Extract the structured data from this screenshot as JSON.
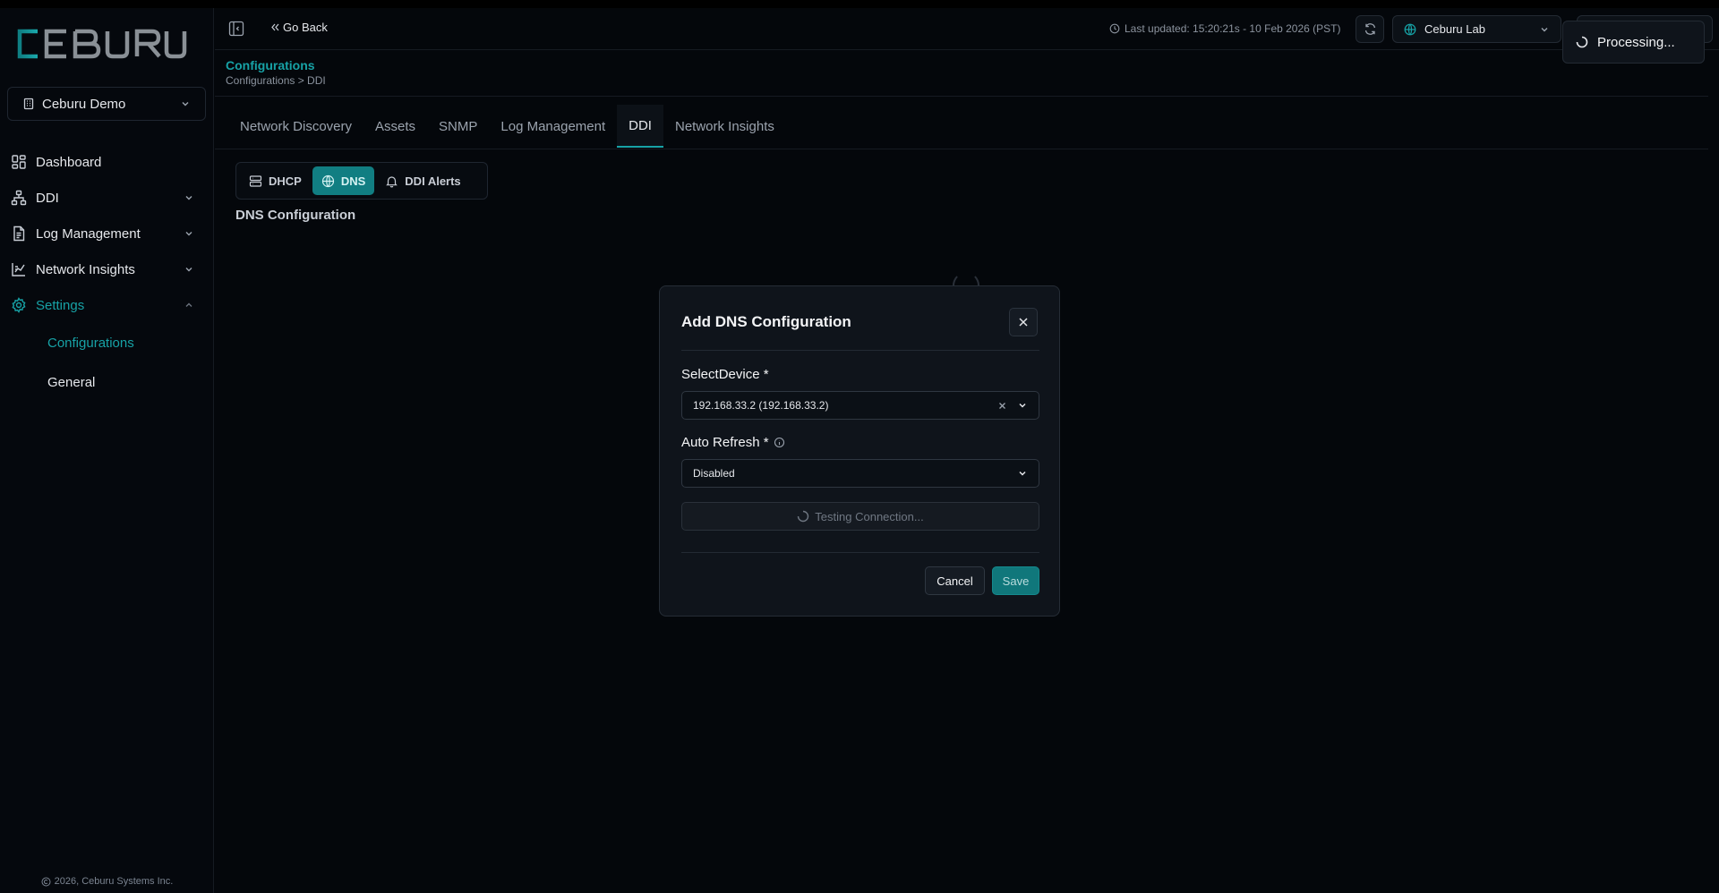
{
  "brand": {
    "logo_text": "CEBURU",
    "accent_color": "#17a2a6"
  },
  "sidebar": {
    "org_selector": "Ceburu Demo",
    "items": [
      {
        "label": "Dashboard",
        "icon": "dashboard-icon"
      },
      {
        "label": "DDI",
        "icon": "network-icon",
        "expandable": true
      },
      {
        "label": "Log Management",
        "icon": "document-icon",
        "expandable": true
      },
      {
        "label": "Network Insights",
        "icon": "chart-icon",
        "expandable": true
      },
      {
        "label": "Settings",
        "icon": "gear-icon",
        "expanded": true,
        "active": true
      }
    ],
    "sub_items": [
      {
        "label": "Configurations",
        "active": true
      },
      {
        "label": "General"
      }
    ],
    "footer": "2026, Ceburu Systems Inc."
  },
  "topbar": {
    "go_back": "Go Back",
    "last_updated": "Last updated: 15:20:21s - 10 Feb 2026 (PST)",
    "site": "Ceburu Lab"
  },
  "toast": {
    "text": "Processing..."
  },
  "page": {
    "title": "Configurations",
    "breadcrumb": "Configurations > DDI",
    "tabs": [
      "Network Discovery",
      "Assets",
      "SNMP",
      "Log Management",
      "DDI",
      "Network Insights"
    ],
    "active_tab": "DDI",
    "subtabs": [
      "DHCP",
      "DNS",
      "DDI Alerts"
    ],
    "active_subtab": "DNS",
    "section_title": "DNS Configuration"
  },
  "modal": {
    "title": "Add DNS Configuration",
    "device_label": "SelectDevice *",
    "device_value": "192.168.33.2 (192.168.33.2)",
    "refresh_label": "Auto Refresh *",
    "refresh_value": "Disabled",
    "test_button": "Testing Connection...",
    "cancel": "Cancel",
    "save": "Save"
  }
}
